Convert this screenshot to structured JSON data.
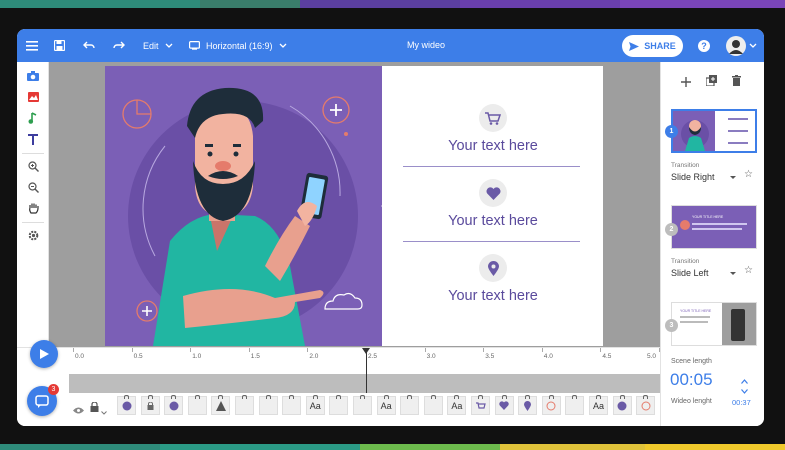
{
  "colors": {
    "accent": "#3d7ee8",
    "slide_purple": "#7b5fb6",
    "text_purple": "#5a4a9c",
    "strip_top": [
      "#2e8b7a",
      "#3a7d6b",
      "#5b3fa0",
      "#6a3fae",
      "#7a45b8"
    ],
    "strip_bot": [
      "#2e8b7a",
      "#2b9b86",
      "#6dbb4d",
      "#e0c23a",
      "#f0c92c"
    ]
  },
  "topbar": {
    "menu_icon": "hamburger-icon",
    "save_icon": "save-icon",
    "undo_icon": "undo-icon",
    "redo_icon": "redo-icon",
    "edit_label": "Edit",
    "layout_label": "Horizontal (16:9)",
    "title": "My wideo",
    "share_label": "SHARE",
    "help_icon": "help-icon",
    "avatar_icon": "avatar-icon"
  },
  "tools": [
    "camera-icon",
    "image-icon",
    "music-icon",
    "text-icon",
    "zoom-in-icon",
    "zoom-out-icon",
    "hand-icon",
    "settings-icon"
  ],
  "slide": {
    "items": [
      {
        "icon": "cart-icon",
        "text": "Your text here"
      },
      {
        "icon": "heart-icon",
        "text": "Your text here"
      },
      {
        "icon": "location-icon",
        "text": "Your text here"
      }
    ]
  },
  "right_panel": {
    "toolbar": [
      "plus-icon",
      "duplicate-icon",
      "trash-icon"
    ],
    "scenes": [
      {
        "number": "1",
        "transition_label": "Transition",
        "transition": "Slide Right",
        "selected": true
      },
      {
        "number": "2",
        "transition_label": "Transition",
        "transition": "Slide Left",
        "selected": false
      },
      {
        "number": "3",
        "selected": false
      }
    ],
    "thumb2_title": "YOUR TITLE HERE",
    "thumb3_title": "YOUR TITLE HERE"
  },
  "timeline": {
    "ticks": [
      "0.0",
      "0.5",
      "1.0",
      "1.5",
      "2.0",
      "2.5",
      "3.0",
      "3.5",
      "4.0",
      "4.5",
      "5.0"
    ],
    "playhead_time": 2.5,
    "chat_badge": "3",
    "layers": [
      "",
      "",
      "",
      "",
      "",
      "",
      "",
      "",
      "Aa",
      "",
      "",
      "Aa",
      "",
      "",
      "Aa",
      "",
      "",
      "",
      "",
      "",
      "Aa",
      "",
      "",
      ""
    ]
  },
  "scene": {
    "label": "Scene length",
    "value": "00:05",
    "wideo_label": "Wideo lenght",
    "wideo_value": "00:37"
  }
}
